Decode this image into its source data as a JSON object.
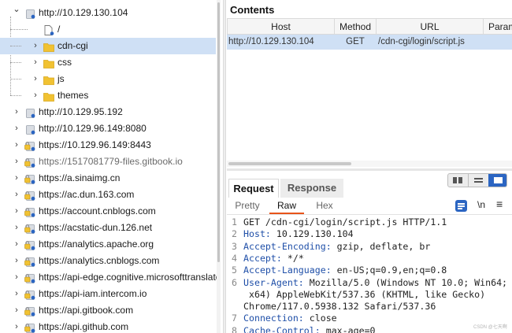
{
  "tree": [
    {
      "label": "http://10.129.130.104",
      "chevron": "down",
      "icon": "host-icon",
      "lock": false,
      "indent": 0
    },
    {
      "label": "/",
      "chevron": "",
      "icon": "file-icon",
      "lock": false,
      "indent": 1
    },
    {
      "label": "cdn-cgi",
      "chevron": "right",
      "icon": "folder-icon",
      "lock": false,
      "indent": 1,
      "selected": true
    },
    {
      "label": "css",
      "chevron": "right",
      "icon": "folder-icon",
      "lock": false,
      "indent": 1
    },
    {
      "label": "js",
      "chevron": "right",
      "icon": "folder-icon",
      "lock": false,
      "indent": 1
    },
    {
      "label": "themes",
      "chevron": "right",
      "icon": "folder-icon",
      "lock": false,
      "indent": 1
    },
    {
      "label": "http://10.129.95.192",
      "chevron": "right",
      "icon": "host-icon",
      "lock": false,
      "indent": 0
    },
    {
      "label": "http://10.129.96.149:8080",
      "chevron": "right",
      "icon": "host-icon",
      "lock": false,
      "indent": 0
    },
    {
      "label": "https://10.129.96.149:8443",
      "chevron": "right",
      "icon": "host-icon",
      "lock": true,
      "indent": 0
    },
    {
      "label": "https://1517081779-files.gitbook.io",
      "chevron": "right",
      "icon": "host-icon",
      "lock": true,
      "indent": 0,
      "muted": true
    },
    {
      "label": "https://a.sinaimg.cn",
      "chevron": "right",
      "icon": "host-icon",
      "lock": true,
      "indent": 0
    },
    {
      "label": "https://ac.dun.163.com",
      "chevron": "right",
      "icon": "host-icon",
      "lock": true,
      "indent": 0
    },
    {
      "label": "https://account.cnblogs.com",
      "chevron": "right",
      "icon": "host-icon",
      "lock": true,
      "indent": 0
    },
    {
      "label": "https://acstatic-dun.126.net",
      "chevron": "right",
      "icon": "host-icon",
      "lock": true,
      "indent": 0
    },
    {
      "label": "https://analytics.apache.org",
      "chevron": "right",
      "icon": "host-icon",
      "lock": true,
      "indent": 0
    },
    {
      "label": "https://analytics.cnblogs.com",
      "chevron": "right",
      "icon": "host-icon",
      "lock": true,
      "indent": 0
    },
    {
      "label": "https://api-edge.cognitive.microsofttranslator.",
      "chevron": "right",
      "icon": "host-icon",
      "lock": true,
      "indent": 0
    },
    {
      "label": "https://api-iam.intercom.io",
      "chevron": "right",
      "icon": "host-icon",
      "lock": true,
      "indent": 0
    },
    {
      "label": "https://api.gitbook.com",
      "chevron": "right",
      "icon": "host-icon",
      "lock": true,
      "indent": 0
    },
    {
      "label": "https://api.github.com",
      "chevron": "right",
      "icon": "host-icon",
      "lock": true,
      "indent": 0
    }
  ],
  "contents": {
    "title": "Contents",
    "columns": [
      "Host",
      "Method",
      "URL",
      "Param"
    ],
    "rows": [
      {
        "host": "http://10.129.130.104",
        "method": "GET",
        "url": "/cdn-cgi/login/script.js",
        "param": ""
      }
    ]
  },
  "request": {
    "tabs": [
      "Request",
      "Response"
    ],
    "subtabs": [
      "Pretty",
      "Raw",
      "Hex"
    ],
    "active_subtab": "Raw",
    "newline_label": "\\n",
    "menu_label": "≡",
    "lines": [
      {
        "n": "1",
        "key": "",
        "rest": "GET /cdn-cgi/login/script.js HTTP/1.1"
      },
      {
        "n": "2",
        "key": "Host:",
        "rest": " 10.129.130.104"
      },
      {
        "n": "3",
        "key": "Accept-Encoding:",
        "rest": " gzip, deflate, br"
      },
      {
        "n": "4",
        "key": "Accept:",
        "rest": " */*"
      },
      {
        "n": "5",
        "key": "Accept-Language:",
        "rest": " en-US;q=0.9,en;q=0.8"
      },
      {
        "n": "6",
        "key": "User-Agent:",
        "rest": " Mozilla/5.0 (Windows NT 10.0; Win64;"
      },
      {
        "n": "",
        "key": "",
        "rest": " x64) AppleWebKit/537.36 (KHTML, like Gecko)"
      },
      {
        "n": "",
        "key": "",
        "rest": "Chrome/117.0.5938.132 Safari/537.36"
      },
      {
        "n": "7",
        "key": "Connection:",
        "rest": " close"
      },
      {
        "n": "8",
        "key": "Cache-Control:",
        "rest": " max-age=0"
      }
    ]
  },
  "watermark": "CSDN @七天啊",
  "colors": {
    "selection": "#cfe0f5",
    "accent": "#2b65c2",
    "tab_underline": "#e8541a",
    "folder": "#f1c232",
    "header_key": "#1f4fa8"
  }
}
